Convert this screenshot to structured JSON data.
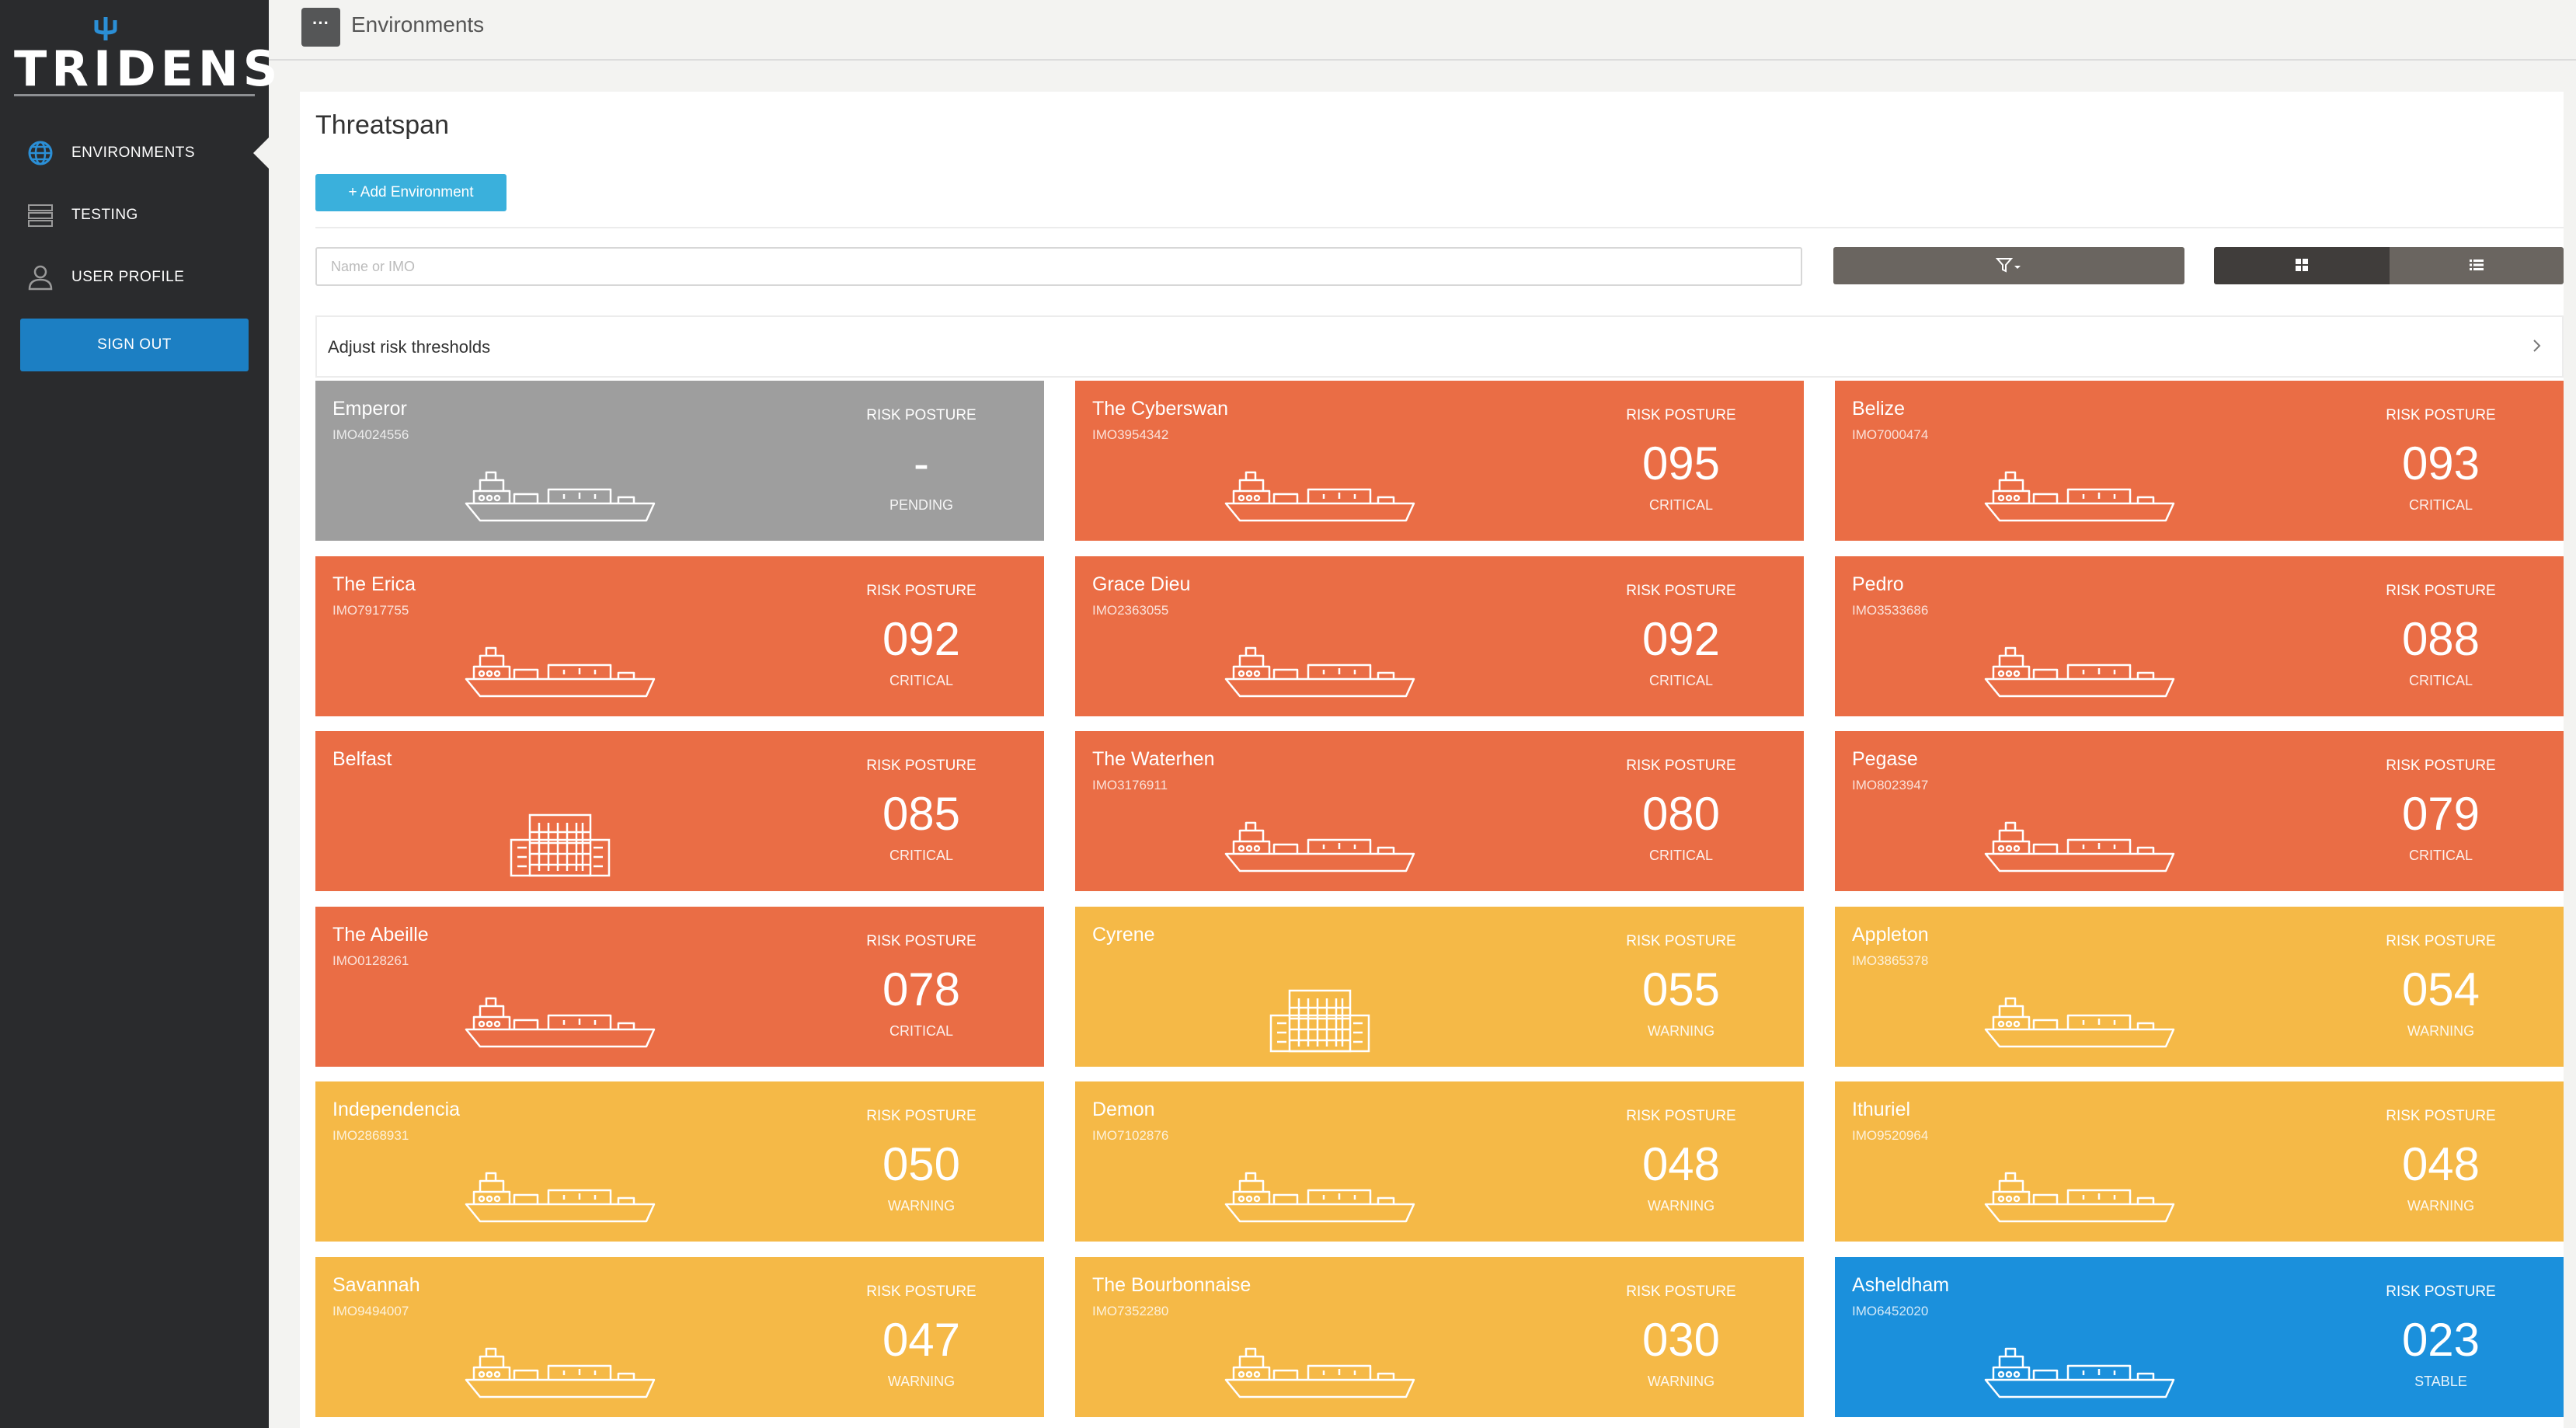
{
  "app": {
    "logo_text": "TRIDENS"
  },
  "sidebar": {
    "items": [
      {
        "label": "ENVIRONMENTS",
        "icon": "globe-icon",
        "active": true
      },
      {
        "label": "TESTING",
        "icon": "server-icon",
        "active": false
      },
      {
        "label": "USER PROFILE",
        "icon": "user-icon",
        "active": false
      }
    ],
    "signout_label": "SIGN OUT"
  },
  "topbar": {
    "menu_label": "···",
    "title": "Environments"
  },
  "main": {
    "title": "Threatspan",
    "add_button": "+ Add Environment",
    "search_placeholder": "Name or IMO",
    "thresholds_label": "Adjust risk thresholds"
  },
  "risk_label": "RISK POSTURE",
  "colors": {
    "critical": "#ea6d45",
    "warning": "#f5b947",
    "stable": "#1b90dc",
    "pending": "#9e9e9e"
  },
  "environments": [
    {
      "name": "Emperor",
      "imo": "IMO4024556",
      "score": "-",
      "status": "PENDING",
      "level": "pending",
      "type": "ship"
    },
    {
      "name": "The Cyberswan",
      "imo": "IMO3954342",
      "score": "095",
      "status": "CRITICAL",
      "level": "critical",
      "type": "ship"
    },
    {
      "name": "Belize",
      "imo": "IMO7000474",
      "score": "093",
      "status": "CRITICAL",
      "level": "critical",
      "type": "ship"
    },
    {
      "name": "The Erica",
      "imo": "IMO7917755",
      "score": "092",
      "status": "CRITICAL",
      "level": "critical",
      "type": "ship"
    },
    {
      "name": "Grace Dieu",
      "imo": "IMO2363055",
      "score": "092",
      "status": "CRITICAL",
      "level": "critical",
      "type": "ship"
    },
    {
      "name": "Pedro",
      "imo": "IMO3533686",
      "score": "088",
      "status": "CRITICAL",
      "level": "critical",
      "type": "ship"
    },
    {
      "name": "Belfast",
      "imo": "",
      "score": "085",
      "status": "CRITICAL",
      "level": "critical",
      "type": "building"
    },
    {
      "name": "The Waterhen",
      "imo": "IMO3176911",
      "score": "080",
      "status": "CRITICAL",
      "level": "critical",
      "type": "ship"
    },
    {
      "name": "Pegase",
      "imo": "IMO8023947",
      "score": "079",
      "status": "CRITICAL",
      "level": "critical",
      "type": "ship"
    },
    {
      "name": "The Abeille",
      "imo": "IMO0128261",
      "score": "078",
      "status": "CRITICAL",
      "level": "critical",
      "type": "ship"
    },
    {
      "name": "Cyrene",
      "imo": "",
      "score": "055",
      "status": "WARNING",
      "level": "warning",
      "type": "building"
    },
    {
      "name": "Appleton",
      "imo": "IMO3865378",
      "score": "054",
      "status": "WARNING",
      "level": "warning",
      "type": "ship"
    },
    {
      "name": "Independencia",
      "imo": "IMO2868931",
      "score": "050",
      "status": "WARNING",
      "level": "warning",
      "type": "ship"
    },
    {
      "name": "Demon",
      "imo": "IMO7102876",
      "score": "048",
      "status": "WARNING",
      "level": "warning",
      "type": "ship"
    },
    {
      "name": "Ithuriel",
      "imo": "IMO9520964",
      "score": "048",
      "status": "WARNING",
      "level": "warning",
      "type": "ship"
    },
    {
      "name": "Savannah",
      "imo": "IMO9494007",
      "score": "047",
      "status": "WARNING",
      "level": "warning",
      "type": "ship"
    },
    {
      "name": "The Bourbonnaise",
      "imo": "IMO7352280",
      "score": "030",
      "status": "WARNING",
      "level": "warning",
      "type": "ship"
    },
    {
      "name": "Asheldham",
      "imo": "IMO6452020",
      "score": "023",
      "status": "STABLE",
      "level": "stable",
      "type": "ship"
    }
  ]
}
